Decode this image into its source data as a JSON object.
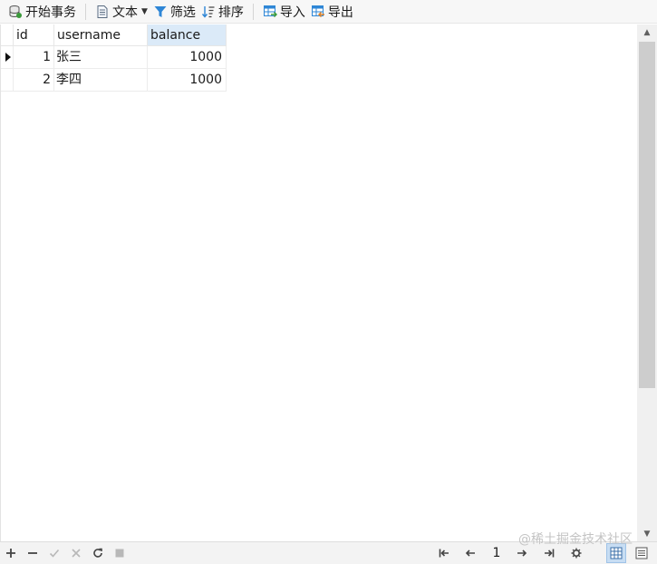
{
  "toolbar": {
    "begin_transaction": "开始事务",
    "text": "文本",
    "filter": "筛选",
    "sort": "排序",
    "import": "导入",
    "export": "导出"
  },
  "columns": [
    "id",
    "username",
    "balance"
  ],
  "rows": [
    {
      "id": "1",
      "username": "张三",
      "balance": "1000"
    },
    {
      "id": "2",
      "username": "李四",
      "balance": "1000"
    }
  ],
  "pagination": {
    "page": "1"
  },
  "watermark": "@稀土掘金技术社区",
  "colors": {
    "selected_header": "#dbeaf8",
    "accent_blue": "#2e86d6",
    "accent_green": "#3a9a3a"
  },
  "icons": {
    "begin_transaction": "database-icon",
    "text": "document-icon",
    "filter": "funnel-icon",
    "sort": "sort-icon",
    "import": "table-import-icon",
    "export": "table-export-icon"
  }
}
